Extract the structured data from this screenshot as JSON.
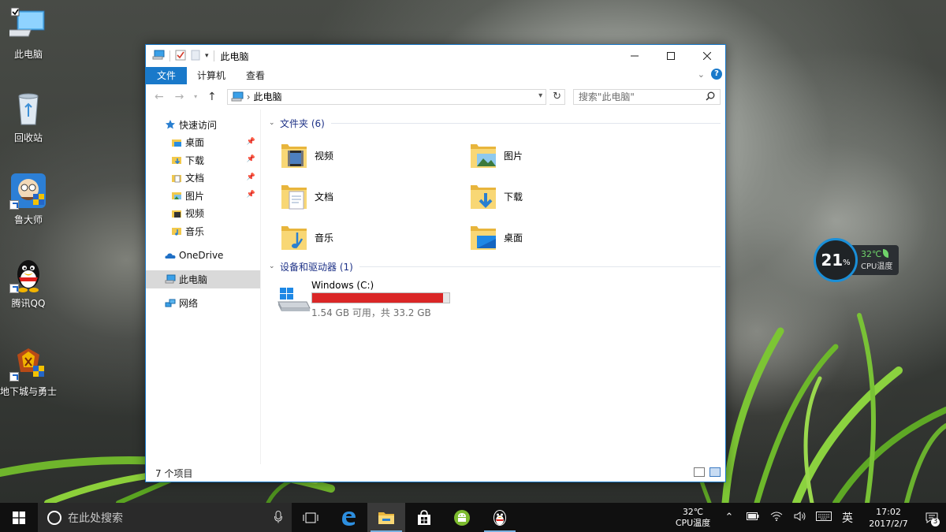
{
  "desktop": {
    "icons": [
      {
        "label": "此电脑",
        "icon": "computer-icon"
      },
      {
        "label": "回收站",
        "icon": "recycle-bin-icon"
      },
      {
        "label": "鲁大师",
        "icon": "ludashi-icon"
      },
      {
        "label": "腾讯QQ",
        "icon": "qq-penguin-icon"
      },
      {
        "label": "地下城与勇士",
        "icon": "dnf-game-icon"
      }
    ]
  },
  "cpu_widget": {
    "usage": "21",
    "usage_unit": "%",
    "temp": "32℃",
    "label": "CPU温度"
  },
  "window": {
    "title": "此电脑",
    "tabs": [
      {
        "label": "文件",
        "active": true
      },
      {
        "label": "计算机"
      },
      {
        "label": "查看"
      }
    ],
    "address": "此电脑",
    "search_placeholder": "搜索\"此电脑\"",
    "nav": {
      "quick_access": "快速访问",
      "quick_items": [
        "桌面",
        "下载",
        "文档",
        "图片",
        "视频",
        "音乐"
      ],
      "onedrive": "OneDrive",
      "this_pc": "此电脑",
      "network": "网络"
    },
    "folders_header": "文件夹 (6)",
    "folders": [
      {
        "name": "视频",
        "icon": "video-folder-icon"
      },
      {
        "name": "图片",
        "icon": "pictures-folder-icon"
      },
      {
        "name": "文档",
        "icon": "documents-folder-icon"
      },
      {
        "name": "下载",
        "icon": "downloads-folder-icon"
      },
      {
        "name": "音乐",
        "icon": "music-folder-icon"
      },
      {
        "name": "桌面",
        "icon": "desktop-folder-icon"
      }
    ],
    "devices_header": "设备和驱动器 (1)",
    "drive": {
      "name": "Windows (C:)",
      "free_text": "1.54 GB 可用，共 33.2 GB",
      "used_fraction": 0.954,
      "bar_color": "#da2626"
    },
    "status": "7 个项目"
  },
  "taskbar": {
    "search_placeholder": "在此处搜索",
    "tray_temp": "32℃",
    "tray_temp_label": "CPU温度",
    "ime": "英",
    "time": "17:02",
    "date": "2017/2/7",
    "notifications": "3"
  },
  "colors": {
    "accent": "#1979ca",
    "group_header": "#1e3287",
    "folder": "#f2c94c"
  }
}
